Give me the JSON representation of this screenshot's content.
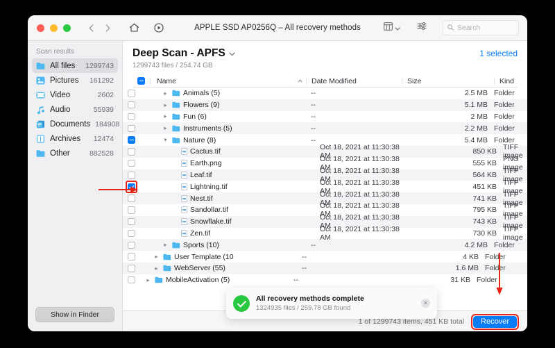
{
  "window": {
    "title": "APPLE SSD AP0256Q – All recovery methods",
    "traffic": [
      "close",
      "minimize",
      "zoom"
    ],
    "nav": {
      "back": "back-chevron",
      "forward": "forward-chevron",
      "home": "home-icon",
      "play": "play-circle-icon"
    },
    "view_button": "view-table-icon",
    "filter_button": "sliders-icon",
    "search": {
      "placeholder": "Search",
      "value": ""
    }
  },
  "sidebar": {
    "heading": "Scan results",
    "items": [
      {
        "label": "All files",
        "count": "1299743",
        "icon": "folder-icon",
        "active": true
      },
      {
        "label": "Pictures",
        "count": "161292",
        "icon": "picture-icon",
        "active": false
      },
      {
        "label": "Video",
        "count": "2602",
        "icon": "video-icon",
        "active": false
      },
      {
        "label": "Audio",
        "count": "55939",
        "icon": "music-note-icon",
        "active": false
      },
      {
        "label": "Documents",
        "count": "184908",
        "icon": "documents-icon",
        "active": false
      },
      {
        "label": "Archives",
        "count": "12474",
        "icon": "archive-icon",
        "active": false
      },
      {
        "label": "Other",
        "count": "882528",
        "icon": "folder-icon",
        "active": false
      }
    ],
    "show_in_finder": "Show in Finder"
  },
  "main": {
    "title": "Deep Scan - APFS",
    "title_chevron": "chevron-down-icon",
    "subtitle": "1299743 files / 254.74 GB",
    "selected_label": "1 selected",
    "columns": {
      "name": "Name",
      "date": "Date Modified",
      "size": "Size",
      "kind": "Kind",
      "sort_arrow": "sort-ascending-icon"
    },
    "header_checkbox_state": "mixed",
    "rows": [
      {
        "name": "Animals (5)",
        "date": "--",
        "size": "2.5 MB",
        "kind": "Folder",
        "type": "folder",
        "indent": 2,
        "disclosure": "collapsed",
        "checkbox": "unchecked",
        "alt": false
      },
      {
        "name": "Flowers (9)",
        "date": "--",
        "size": "5.1 MB",
        "kind": "Folder",
        "type": "folder",
        "indent": 2,
        "disclosure": "collapsed",
        "checkbox": "unchecked",
        "alt": true
      },
      {
        "name": "Fun (6)",
        "date": "--",
        "size": "2 MB",
        "kind": "Folder",
        "type": "folder",
        "indent": 2,
        "disclosure": "collapsed",
        "checkbox": "unchecked",
        "alt": false
      },
      {
        "name": "Instruments (5)",
        "date": "--",
        "size": "2.2 MB",
        "kind": "Folder",
        "type": "folder",
        "indent": 2,
        "disclosure": "collapsed",
        "checkbox": "unchecked",
        "alt": true
      },
      {
        "name": "Nature (8)",
        "date": "--",
        "size": "5.4 MB",
        "kind": "Folder",
        "type": "folder",
        "indent": 2,
        "disclosure": "expanded",
        "checkbox": "mixed",
        "alt": false
      },
      {
        "name": "Cactus.tif",
        "date": "Oct 18, 2021 at 11:30:38 AM",
        "size": "850 KB",
        "kind": "TIFF image",
        "type": "file",
        "indent": 3,
        "disclosure": "none",
        "checkbox": "unchecked",
        "alt": true
      },
      {
        "name": "Earth.png",
        "date": "Oct 18, 2021 at 11:30:38 AM",
        "size": "555 KB",
        "kind": "PNG image",
        "type": "file",
        "indent": 3,
        "disclosure": "none",
        "checkbox": "unchecked",
        "alt": false
      },
      {
        "name": "Leaf.tif",
        "date": "Oct 18, 2021 at 11:30:38 AM",
        "size": "564 KB",
        "kind": "TIFF image",
        "type": "file",
        "indent": 3,
        "disclosure": "none",
        "checkbox": "unchecked",
        "alt": true
      },
      {
        "name": "Lightning.tif",
        "date": "Oct 18, 2021 at 11:30:38 AM",
        "size": "451 KB",
        "kind": "TIFF image",
        "type": "file",
        "indent": 3,
        "disclosure": "none",
        "checkbox": "checked",
        "alt": false,
        "highlight": true
      },
      {
        "name": "Nest.tif",
        "date": "Oct 18, 2021 at 11:30:38 AM",
        "size": "741 KB",
        "kind": "TIFF image",
        "type": "file",
        "indent": 3,
        "disclosure": "none",
        "checkbox": "unchecked",
        "alt": true
      },
      {
        "name": "Sandollar.tif",
        "date": "Oct 18, 2021 at 11:30:38 AM",
        "size": "795 KB",
        "kind": "TIFF image",
        "type": "file",
        "indent": 3,
        "disclosure": "none",
        "checkbox": "unchecked",
        "alt": false
      },
      {
        "name": "Snowflake.tif",
        "date": "Oct 18, 2021 at 11:30:38 AM",
        "size": "743 KB",
        "kind": "TIFF image",
        "type": "file",
        "indent": 3,
        "disclosure": "none",
        "checkbox": "unchecked",
        "alt": true
      },
      {
        "name": "Zen.tif",
        "date": "Oct 18, 2021 at 11:30:38 AM",
        "size": "730 KB",
        "kind": "TIFF image",
        "type": "file",
        "indent": 3,
        "disclosure": "none",
        "checkbox": "unchecked",
        "alt": false
      },
      {
        "name": "Sports (10)",
        "date": "--",
        "size": "4.2 MB",
        "kind": "Folder",
        "type": "folder",
        "indent": 2,
        "disclosure": "collapsed",
        "checkbox": "unchecked",
        "alt": true
      },
      {
        "name": "User Template (10",
        "date": "--",
        "size": "4 KB",
        "kind": "Folder",
        "type": "folder",
        "indent": 1,
        "disclosure": "collapsed",
        "checkbox": "unchecked",
        "alt": false
      },
      {
        "name": "WebServer (55)",
        "date": "--",
        "size": "1.6 MB",
        "kind": "Folder",
        "type": "folder",
        "indent": 1,
        "disclosure": "collapsed",
        "checkbox": "unchecked",
        "alt": true
      },
      {
        "name": "MobileActivation (5)",
        "date": "--",
        "size": "31 KB",
        "kind": "Folder",
        "type": "folder",
        "indent": 0,
        "disclosure": "collapsed",
        "checkbox": "unchecked",
        "alt": false
      }
    ]
  },
  "toast": {
    "icon": "success-check-icon",
    "title": "All recovery methods complete",
    "subtitle": "1324935 files / 259.78 GB found",
    "close": "close-icon"
  },
  "footer": {
    "info": "1 of 1299743 items, 451 KB total",
    "recover_label": "Recover"
  },
  "annotations": {
    "arrow_to_checkbox": "red-arrow-right",
    "arrow_to_recover": "red-arrow-down",
    "color": "#e8271a"
  },
  "colors": {
    "accent": "#0a7cf6",
    "success": "#28c840",
    "annotation": "#e8271a",
    "folder": "#4db8f0"
  }
}
